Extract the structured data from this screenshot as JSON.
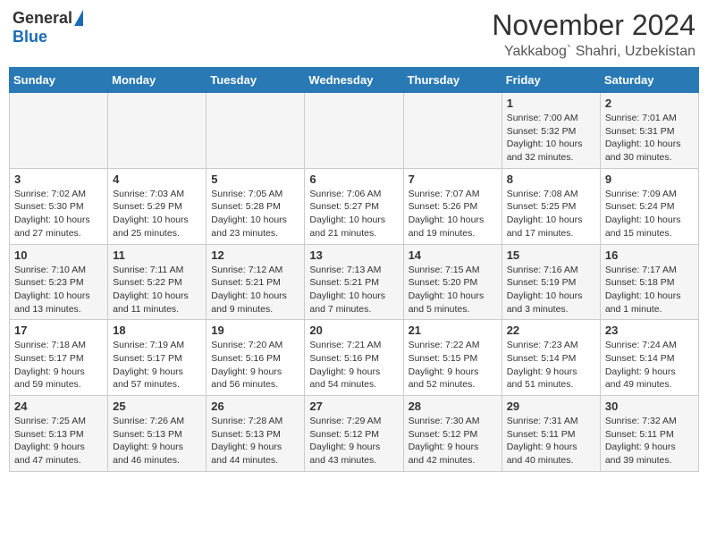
{
  "header": {
    "logo_general": "General",
    "logo_blue": "Blue",
    "month_title": "November 2024",
    "location": "Yakkabog` Shahri, Uzbekistan"
  },
  "weekdays": [
    "Sunday",
    "Monday",
    "Tuesday",
    "Wednesday",
    "Thursday",
    "Friday",
    "Saturday"
  ],
  "weeks": [
    [
      {
        "day": "",
        "info": ""
      },
      {
        "day": "",
        "info": ""
      },
      {
        "day": "",
        "info": ""
      },
      {
        "day": "",
        "info": ""
      },
      {
        "day": "",
        "info": ""
      },
      {
        "day": "1",
        "info": "Sunrise: 7:00 AM\nSunset: 5:32 PM\nDaylight: 10 hours\nand 32 minutes."
      },
      {
        "day": "2",
        "info": "Sunrise: 7:01 AM\nSunset: 5:31 PM\nDaylight: 10 hours\nand 30 minutes."
      }
    ],
    [
      {
        "day": "3",
        "info": "Sunrise: 7:02 AM\nSunset: 5:30 PM\nDaylight: 10 hours\nand 27 minutes."
      },
      {
        "day": "4",
        "info": "Sunrise: 7:03 AM\nSunset: 5:29 PM\nDaylight: 10 hours\nand 25 minutes."
      },
      {
        "day": "5",
        "info": "Sunrise: 7:05 AM\nSunset: 5:28 PM\nDaylight: 10 hours\nand 23 minutes."
      },
      {
        "day": "6",
        "info": "Sunrise: 7:06 AM\nSunset: 5:27 PM\nDaylight: 10 hours\nand 21 minutes."
      },
      {
        "day": "7",
        "info": "Sunrise: 7:07 AM\nSunset: 5:26 PM\nDaylight: 10 hours\nand 19 minutes."
      },
      {
        "day": "8",
        "info": "Sunrise: 7:08 AM\nSunset: 5:25 PM\nDaylight: 10 hours\nand 17 minutes."
      },
      {
        "day": "9",
        "info": "Sunrise: 7:09 AM\nSunset: 5:24 PM\nDaylight: 10 hours\nand 15 minutes."
      }
    ],
    [
      {
        "day": "10",
        "info": "Sunrise: 7:10 AM\nSunset: 5:23 PM\nDaylight: 10 hours\nand 13 minutes."
      },
      {
        "day": "11",
        "info": "Sunrise: 7:11 AM\nSunset: 5:22 PM\nDaylight: 10 hours\nand 11 minutes."
      },
      {
        "day": "12",
        "info": "Sunrise: 7:12 AM\nSunset: 5:21 PM\nDaylight: 10 hours\nand 9 minutes."
      },
      {
        "day": "13",
        "info": "Sunrise: 7:13 AM\nSunset: 5:21 PM\nDaylight: 10 hours\nand 7 minutes."
      },
      {
        "day": "14",
        "info": "Sunrise: 7:15 AM\nSunset: 5:20 PM\nDaylight: 10 hours\nand 5 minutes."
      },
      {
        "day": "15",
        "info": "Sunrise: 7:16 AM\nSunset: 5:19 PM\nDaylight: 10 hours\nand 3 minutes."
      },
      {
        "day": "16",
        "info": "Sunrise: 7:17 AM\nSunset: 5:18 PM\nDaylight: 10 hours\nand 1 minute."
      }
    ],
    [
      {
        "day": "17",
        "info": "Sunrise: 7:18 AM\nSunset: 5:17 PM\nDaylight: 9 hours\nand 59 minutes."
      },
      {
        "day": "18",
        "info": "Sunrise: 7:19 AM\nSunset: 5:17 PM\nDaylight: 9 hours\nand 57 minutes."
      },
      {
        "day": "19",
        "info": "Sunrise: 7:20 AM\nSunset: 5:16 PM\nDaylight: 9 hours\nand 56 minutes."
      },
      {
        "day": "20",
        "info": "Sunrise: 7:21 AM\nSunset: 5:16 PM\nDaylight: 9 hours\nand 54 minutes."
      },
      {
        "day": "21",
        "info": "Sunrise: 7:22 AM\nSunset: 5:15 PM\nDaylight: 9 hours\nand 52 minutes."
      },
      {
        "day": "22",
        "info": "Sunrise: 7:23 AM\nSunset: 5:14 PM\nDaylight: 9 hours\nand 51 minutes."
      },
      {
        "day": "23",
        "info": "Sunrise: 7:24 AM\nSunset: 5:14 PM\nDaylight: 9 hours\nand 49 minutes."
      }
    ],
    [
      {
        "day": "24",
        "info": "Sunrise: 7:25 AM\nSunset: 5:13 PM\nDaylight: 9 hours\nand 47 minutes."
      },
      {
        "day": "25",
        "info": "Sunrise: 7:26 AM\nSunset: 5:13 PM\nDaylight: 9 hours\nand 46 minutes."
      },
      {
        "day": "26",
        "info": "Sunrise: 7:28 AM\nSunset: 5:13 PM\nDaylight: 9 hours\nand 44 minutes."
      },
      {
        "day": "27",
        "info": "Sunrise: 7:29 AM\nSunset: 5:12 PM\nDaylight: 9 hours\nand 43 minutes."
      },
      {
        "day": "28",
        "info": "Sunrise: 7:30 AM\nSunset: 5:12 PM\nDaylight: 9 hours\nand 42 minutes."
      },
      {
        "day": "29",
        "info": "Sunrise: 7:31 AM\nSunset: 5:11 PM\nDaylight: 9 hours\nand 40 minutes."
      },
      {
        "day": "30",
        "info": "Sunrise: 7:32 AM\nSunset: 5:11 PM\nDaylight: 9 hours\nand 39 minutes."
      }
    ]
  ]
}
